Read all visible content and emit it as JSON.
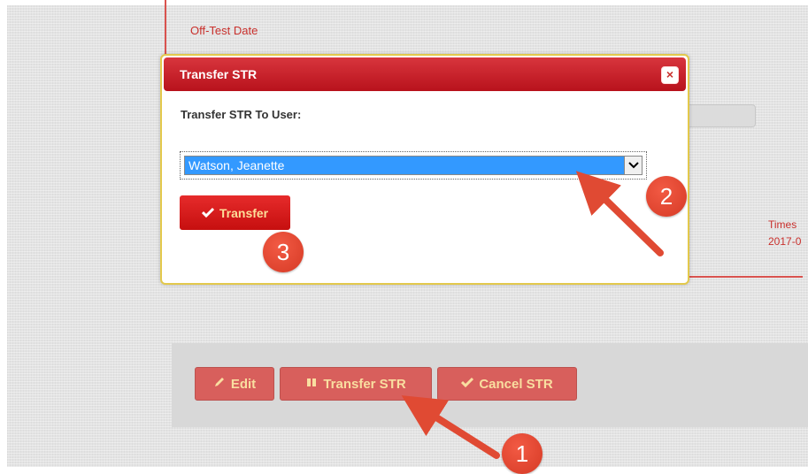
{
  "background": {
    "field_label": "Off-Test Date",
    "times_label": "Times",
    "times_value": "2017-0",
    "buttons": {
      "edit": "Edit",
      "transfer": "Transfer STR",
      "cancel": "Cancel STR"
    }
  },
  "modal": {
    "title": "Transfer STR",
    "close_glyph": "×",
    "label": "Transfer STR To User:",
    "selected_user": "Watson, Jeanette",
    "transfer_button": "Transfer"
  },
  "annotations": {
    "step1": "1",
    "step2": "2",
    "step3": "3"
  },
  "colors": {
    "accent": "#d9534f",
    "header": "#c2161f",
    "modal_border": "#e3c94c",
    "button_text": "#fddf9a",
    "select_highlight": "#3399ff",
    "callout": "#e04a33"
  },
  "icons": {
    "edit": "pencil-icon",
    "transfer": "transfer-icon",
    "cancel": "check-icon",
    "close": "close-icon",
    "dropdown": "chevron-down-icon",
    "transfer_modal": "check-icon"
  }
}
